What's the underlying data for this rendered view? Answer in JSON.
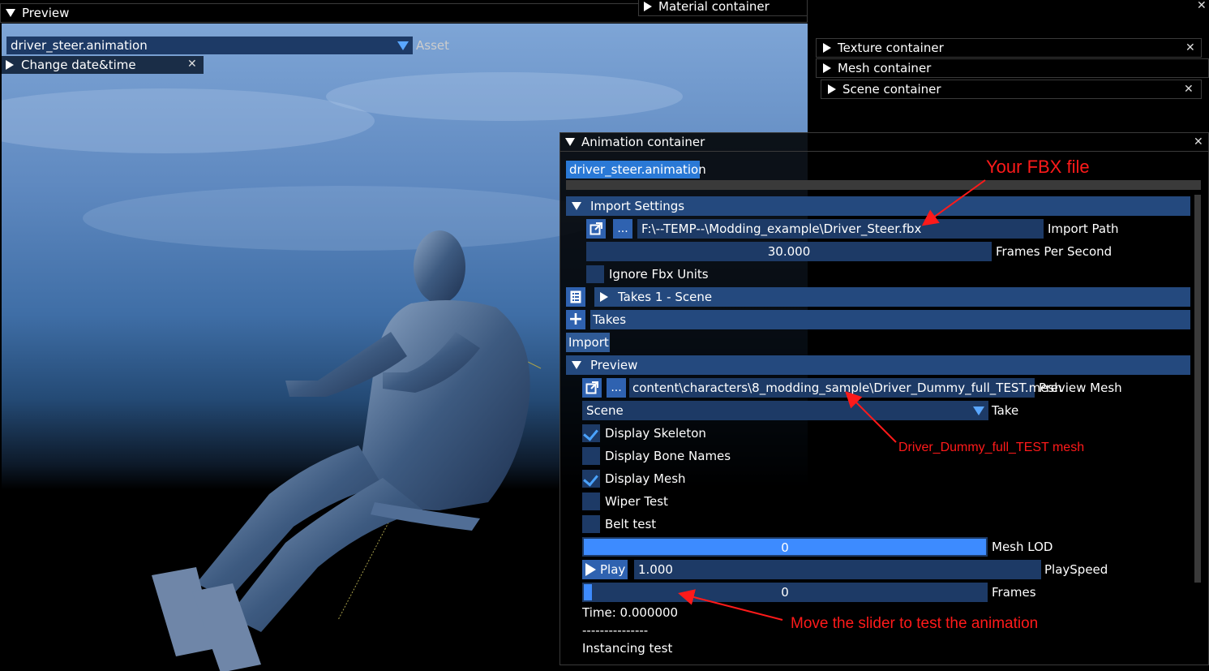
{
  "preview_window": {
    "title": "Preview",
    "asset_value": "driver_steer.animation",
    "asset_label": "Asset",
    "change_datetime": "Change date&time"
  },
  "containers": {
    "material": "Material container",
    "texture": "Texture container",
    "mesh": "Mesh container",
    "scene": "Scene container"
  },
  "animation": {
    "title": "Animation container",
    "selected_asset": "driver_steer.animation",
    "import_settings": {
      "header": "Import Settings",
      "browse_label": "...",
      "import_path": "F:\\--TEMP--\\Modding_example\\Driver_Steer.fbx",
      "import_path_label": "Import Path",
      "fps_value": "30.000",
      "fps_label": "Frames Per Second",
      "ignore_units_label": "Ignore Fbx Units",
      "takes_tree": "Takes 1 - Scene",
      "takes_label": "Takes",
      "import_button": "Import"
    },
    "preview": {
      "header": "Preview",
      "browse_label": "...",
      "mesh_path": "content\\characters\\8_modding_sample\\Driver_Dummy_full_TEST.mesh",
      "mesh_label": "Preview Mesh",
      "take_value": "Scene",
      "take_label": "Take",
      "display_skeleton": "Display Skeleton",
      "display_bone_names": "Display Bone Names",
      "display_mesh": "Display Mesh",
      "wiper_test": "Wiper Test",
      "belt_test": "Belt test",
      "mesh_lod_value": "0",
      "mesh_lod_label": "Mesh LOD",
      "mesh_lod_fill": 1.0,
      "play_label": "Play",
      "playspeed_value": "1.000",
      "playspeed_label": "PlaySpeed",
      "frames_value": "0",
      "frames_label": "Frames",
      "frames_fill": 0.02,
      "time_text": "Time: 0.000000",
      "divider_text": "---------------",
      "instancing_text": "Instancing test"
    }
  },
  "annotations": {
    "fbx": "Your FBX file",
    "mesh": "Driver_Dummy_full_TEST  mesh",
    "slider": "Move the slider to test the animation"
  },
  "colors": {
    "annotation_red": "#ff1a1a",
    "header_blue": "#24497e",
    "field_blue": "#1d3a66",
    "accent_blue": "#3d8bff"
  }
}
